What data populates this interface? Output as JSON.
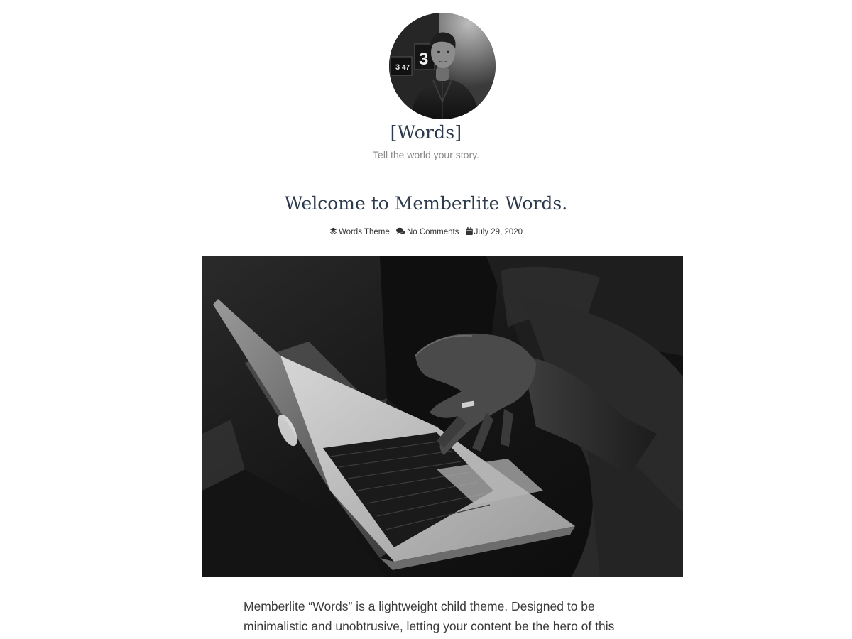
{
  "site": {
    "title": "[Words]",
    "tagline": "Tell the world your story."
  },
  "avatar": {
    "monitor_numbers": [
      "3",
      "47",
      "3"
    ]
  },
  "post": {
    "title": "Welcome to Memberlite Words.",
    "meta": {
      "category": "Words Theme",
      "comments": "No Comments",
      "date": "July 29, 2020"
    },
    "icons": {
      "category": "layers-icon",
      "comments": "comments-icon",
      "date": "calendar-icon"
    },
    "content": "Memberlite “Words” is a lightweight child theme. Designed to be minimalistic and unobtrusive, letting your content be the hero of this"
  },
  "colors": {
    "heading": "#2c3a4d",
    "tagline": "#8a8a8a",
    "body_text": "#3a3a3a",
    "background": "#ffffff"
  }
}
